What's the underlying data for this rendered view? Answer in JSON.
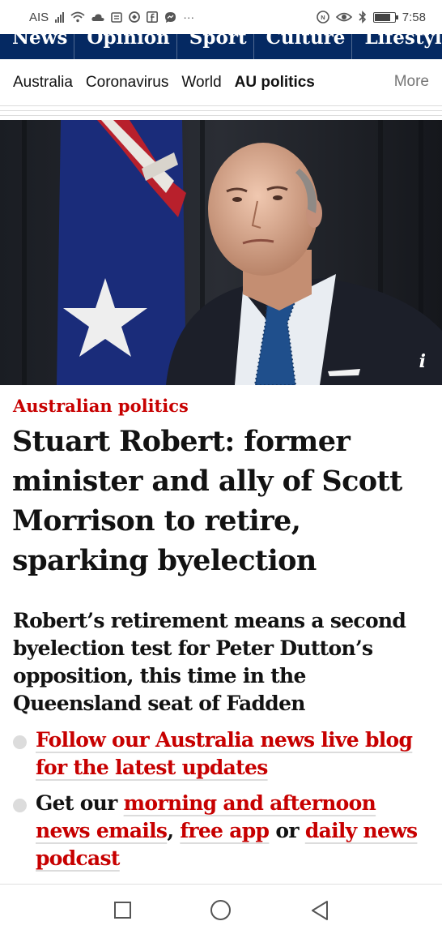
{
  "status_bar": {
    "carrier": "AIS",
    "time": "7:58",
    "left_icons": [
      "signal-icon",
      "wifi-icon",
      "cloud-icon",
      "sim-icon",
      "shield-icon",
      "facebook-icon",
      "messenger-icon",
      "more-dots-icon"
    ],
    "right_icons": [
      "nfc-icon",
      "eye-icon",
      "bluetooth-icon",
      "battery-icon"
    ],
    "more_glyph": "···",
    "battery_level": 0.75
  },
  "pillars": [
    "News",
    "Opinion",
    "Sport",
    "Culture",
    "Lifestyle"
  ],
  "subnav": {
    "items": [
      "Australia",
      "Coronavirus",
      "World",
      "AU politics"
    ],
    "active": "AU politics",
    "more": "More"
  },
  "hero": {
    "info_label": "i"
  },
  "article": {
    "kicker": "Australian politics",
    "headline": "Stuart Robert: former minister and ally of Scott Morrison to retire, sparking byelection",
    "standfirst": "Robert’s retirement means a second byelection test for Peter Dutton’s opposition, this time in the Queensland seat of Fadden",
    "bullet1": {
      "link": "Follow our Australia news live blog for the latest updates"
    },
    "bullet2": {
      "prefix": "Get our ",
      "link1": "morning and afternoon news emails",
      "sep1": ", ",
      "link2": "free app",
      "sep2": " or ",
      "link3": "daily news podcast"
    }
  },
  "colors": {
    "pillar_bg": "#052962",
    "accent_red": "#c70000",
    "text": "#121212"
  },
  "bottom_nav": {
    "icons": [
      "recent-apps-icon",
      "home-icon",
      "back-icon"
    ]
  }
}
